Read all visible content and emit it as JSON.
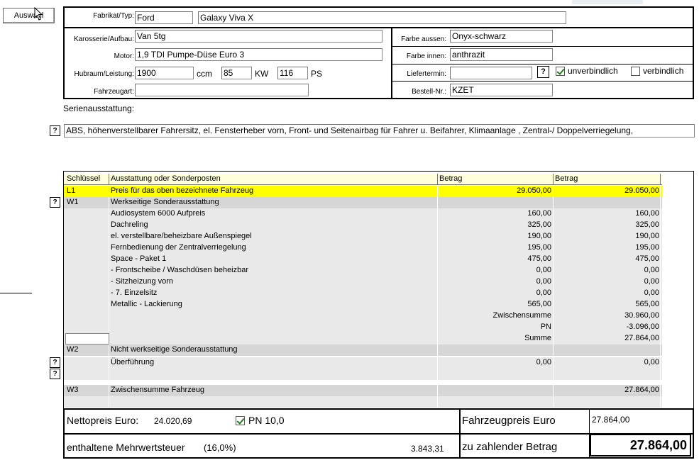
{
  "top": {
    "select_button": "Auswahl"
  },
  "vehicle": {
    "make_label": "Fabrikat/Typ:",
    "make": "Ford",
    "model": "Galaxy Viva X",
    "body_label": "Karosserie/Aufbau:",
    "body": "Van 5tg",
    "engine_label": "Motor:",
    "engine": "1,9 TDI Pumpe-Düse Euro 3",
    "power_label": "Hubraum/Leistung:",
    "displacement": "1900",
    "displacement_unit": "ccm",
    "kw": "85",
    "kw_unit": "KW",
    "ps": "116",
    "ps_unit": "PS",
    "vehicle_type_label": "Fahrzeugart:",
    "vehicle_type": "",
    "color_outside_label": "Farbe aussen:",
    "color_outside": "Onyx-schwarz",
    "color_inside_label": "Farbe innen:",
    "color_inside": "anthrazit",
    "delivery_label": "Liefertermin:",
    "delivery": "",
    "nonbinding_label": "unverbindlich",
    "nonbinding_checked": true,
    "binding_label": "verbindlich",
    "binding_checked": false,
    "order_no_label": "Bestell-Nr.:",
    "order_no": "KZET"
  },
  "series": {
    "label": "Serienausstattung:",
    "text": "ABS, höhenverstellbarer Fahrersitz, el. Fensterheber vorn, Front- und Seitenairbag für Fahrer u. Beifahrer, Klimaanlage , Zentral-/ Doppelverriegelung,"
  },
  "table": {
    "headers": [
      "Schlüssel",
      "Ausstattung oder Sonderposten",
      "Betrag",
      "Betrag"
    ],
    "rows": [
      {
        "key": "L1",
        "desc": "Preis für das oben bezeichnete Fahrzeug",
        "amount": "29.050,00",
        "total": "29.050,00"
      },
      {
        "key": "W1",
        "desc": "Werkseitige Sonderausstattung",
        "amount": "",
        "total": ""
      },
      {
        "key": "",
        "desc": "Audiosystem 6000 Aufpreis",
        "amount": "160,00",
        "total": "160,00"
      },
      {
        "key": "",
        "desc": "Dachreling",
        "amount": "325,00",
        "total": "325,00"
      },
      {
        "key": "",
        "desc": "el. verstellbare/beheizbare Außenspiegel",
        "amount": "190,00",
        "total": "190,00"
      },
      {
        "key": "",
        "desc": "Fernbedienung der Zentralverriegelung",
        "amount": "195,00",
        "total": "195,00"
      },
      {
        "key": "",
        "desc": "Space - Paket 1",
        "amount": "475,00",
        "total": "475,00"
      },
      {
        "key": "",
        "desc": "- Frontscheibe / Waschdüsen beheizbar",
        "amount": "0,00",
        "total": "0,00"
      },
      {
        "key": "",
        "desc": "- Sitzheizung vorn",
        "amount": "0,00",
        "total": "0,00"
      },
      {
        "key": "",
        "desc": "- 7. Einzelsitz",
        "amount": "0,00",
        "total": "0,00"
      },
      {
        "key": "",
        "desc": "Metallic - Lackierung",
        "amount": "565,00",
        "total": "565,00"
      },
      {
        "key": "",
        "desc": "",
        "amount": "Zwischensumme",
        "total": "30.960,00"
      },
      {
        "key": "",
        "desc": "",
        "amount": "PN",
        "total": "-3.096,00"
      },
      {
        "key": "",
        "desc": "",
        "amount": "Summe",
        "total": "27.864,00"
      },
      {
        "key": "W2",
        "desc": "Nicht werkseitige Sonderausstattung",
        "amount": "",
        "total": ""
      },
      {
        "key": "",
        "desc": "Überführung",
        "amount": "0,00",
        "total": "0,00"
      },
      {
        "key": "",
        "desc": "",
        "amount": "",
        "total": ""
      },
      {
        "key": "W3",
        "desc": "Zwischensumme Fahrzeug",
        "amount": "",
        "total": "27.864,00"
      },
      {
        "key": "",
        "desc": "",
        "amount": "",
        "total": ""
      }
    ]
  },
  "footer": {
    "net_label": "Nettopreis Euro:",
    "net_value": "24.020,69",
    "pn_label": "PN 10,0",
    "pn_checked": true,
    "vehicle_price_label": "Fahrzeugpreis Euro",
    "vehicle_price": "27.864,00",
    "vat_label": "enthaltene Mehrwertsteuer",
    "vat_rate": "(16,0%)",
    "vat_value": "3.843,31",
    "pay_label": "zu zahlender Betrag",
    "pay_value": "27.864,00"
  },
  "colors": {
    "highlight": "#ffff00",
    "group_row": "#d6d6d6",
    "item_row": "#e9e9e9",
    "header_row": "#ffffdc",
    "check": "#1a7f1a"
  }
}
